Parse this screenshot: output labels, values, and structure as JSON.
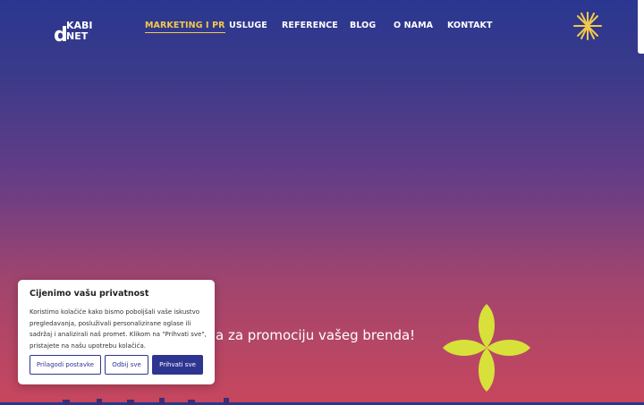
{
  "header": {
    "logo_text_1": "KABI",
    "logo_text_2": "NET",
    "logo_letter": "d",
    "nav": [
      {
        "label": "MARKETING I PR",
        "active": true
      },
      {
        "label": "USLUGE"
      },
      {
        "label": "REFERENCE"
      },
      {
        "label": "BLOG"
      },
      {
        "label": "O NAMA"
      },
      {
        "label": "KONTAKT"
      }
    ]
  },
  "hero": {
    "subtitle_visible": "a za promociju vašeg brenda!"
  },
  "cookie": {
    "title": "Cijenimo vašu privatnost",
    "body": "Koristimo kolačiće kako bismo poboljšali vaše iskustvo pregledavanja, posluživali personalizirane oglase ili sadržaj i analizirali naš promet. Klikom na \"Prihvati sve\", pristajete na našu upotrebu kolačića.",
    "customize_label": "Prilagodi postavke",
    "reject_label": "Odbij sve",
    "accept_label": "Prihvati sve"
  },
  "colors": {
    "accent": "#f2c94c",
    "flower": "#d8e13a",
    "button_primary": "#2e3590"
  }
}
